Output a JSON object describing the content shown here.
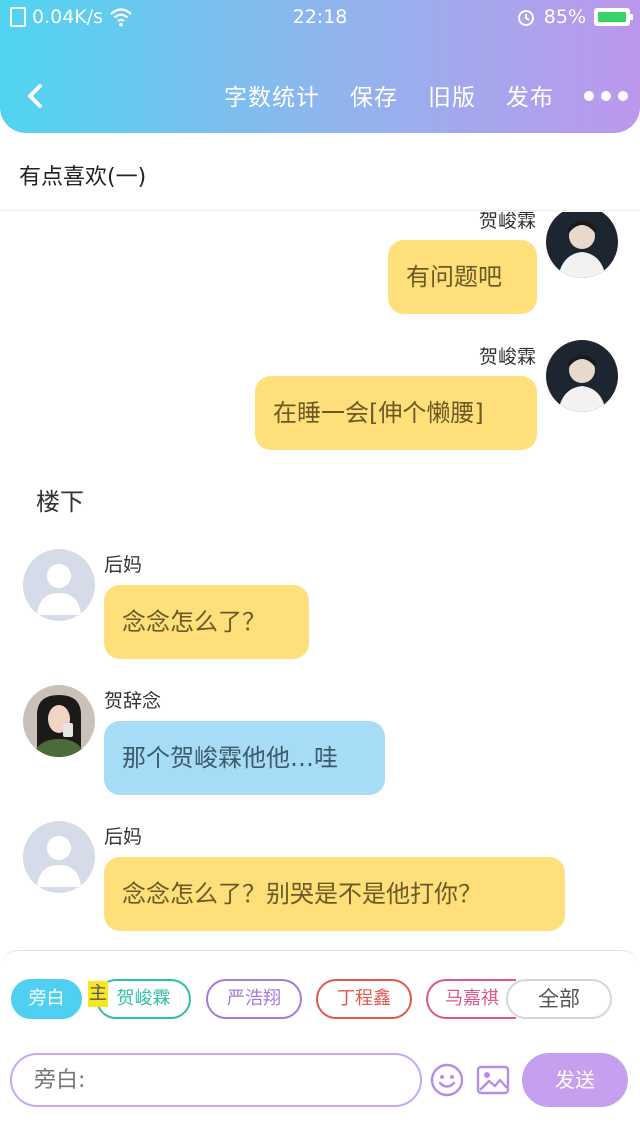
{
  "status_bar": {
    "network_speed": "0.04K/s",
    "time": "22:18",
    "battery": "85%"
  },
  "toolbar": {
    "word_count": "字数统计",
    "save": "保存",
    "old_version": "旧版",
    "publish": "发布"
  },
  "document": {
    "title": "有点喜欢(一)"
  },
  "messages": [
    {
      "side": "right",
      "speaker": "贺峻霖",
      "text": "有问题吧",
      "bubble_color": "#fedf7a"
    },
    {
      "side": "right",
      "speaker": "贺峻霖",
      "text": "在睡一会[伸个懒腰]",
      "bubble_color": "#fedf7a"
    },
    {
      "type": "narration",
      "text": "楼下"
    },
    {
      "side": "left",
      "speaker": "后妈",
      "text": "念念怎么了？",
      "bubble_color": "#fedf7a"
    },
    {
      "side": "left",
      "speaker": "贺辞念",
      "text": "那个贺峻霖他他…哇",
      "bubble_color": "#a7dcf6"
    },
    {
      "side": "left",
      "speaker": "后妈",
      "text": "念念怎么了？别哭是不是他打你？",
      "bubble_color": "#fedf7a"
    }
  ],
  "roles": {
    "tag": "主",
    "chips": [
      {
        "label": "旁白",
        "color": "#4fcff2",
        "active": true
      },
      {
        "label": "贺峻霖",
        "color": "#2fbfa8"
      },
      {
        "label": "严浩翔",
        "color": "#a57bd8"
      },
      {
        "label": "丁程鑫",
        "color": "#e4574e"
      },
      {
        "label": "马嘉祺",
        "color": "#e0578c"
      },
      {
        "label": "全部",
        "color": "#cccccc"
      }
    ]
  },
  "composer": {
    "placeholder": "旁白:",
    "send": "发送"
  }
}
